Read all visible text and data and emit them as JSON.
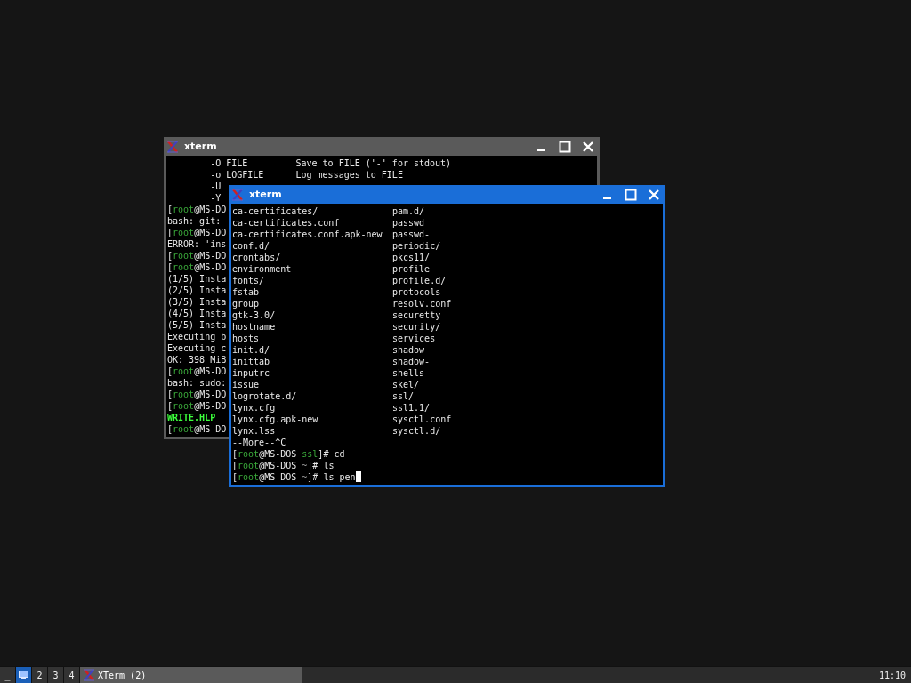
{
  "windows": [
    {
      "title": "xterm",
      "active": false,
      "lines": [
        [
          {
            "text": "        -O FILE         Save to FILE ('-' for stdout)",
            "kind": "plain"
          }
        ],
        [
          {
            "text": "        -o LOGFILE      Log messages to FILE",
            "kind": "plain"
          }
        ],
        [
          {
            "text": "        -U",
            "kind": "plain"
          }
        ],
        [
          {
            "text": "        -Y",
            "kind": "plain"
          }
        ],
        [
          {
            "text": "[",
            "kind": "plain"
          },
          {
            "text": "root",
            "kind": "green"
          },
          {
            "text": "@MS-DO",
            "kind": "plain"
          }
        ],
        [
          {
            "text": "bash: git:",
            "kind": "plain"
          }
        ],
        [
          {
            "text": "[",
            "kind": "plain"
          },
          {
            "text": "root",
            "kind": "green"
          },
          {
            "text": "@MS-DO",
            "kind": "plain"
          }
        ],
        [
          {
            "text": "ERROR: 'ins",
            "kind": "plain"
          }
        ],
        [
          {
            "text": "[",
            "kind": "plain"
          },
          {
            "text": "root",
            "kind": "green"
          },
          {
            "text": "@MS-DO",
            "kind": "plain"
          }
        ],
        [
          {
            "text": "[",
            "kind": "plain"
          },
          {
            "text": "root",
            "kind": "green"
          },
          {
            "text": "@MS-DO",
            "kind": "plain"
          }
        ],
        [
          {
            "text": "(1/5) Insta",
            "kind": "plain"
          }
        ],
        [
          {
            "text": "(2/5) Insta",
            "kind": "plain"
          }
        ],
        [
          {
            "text": "(3/5) Insta",
            "kind": "plain"
          }
        ],
        [
          {
            "text": "(4/5) Insta",
            "kind": "plain"
          }
        ],
        [
          {
            "text": "(5/5) Insta",
            "kind": "plain"
          }
        ],
        [
          {
            "text": "Executing b",
            "kind": "plain"
          }
        ],
        [
          {
            "text": "Executing c",
            "kind": "plain"
          }
        ],
        [
          {
            "text": "OK: 398 MiB",
            "kind": "plain"
          }
        ],
        [
          {
            "text": "[",
            "kind": "plain"
          },
          {
            "text": "root",
            "kind": "green"
          },
          {
            "text": "@MS-DO",
            "kind": "plain"
          }
        ],
        [
          {
            "text": "bash: sudo:",
            "kind": "plain"
          }
        ],
        [
          {
            "text": "[",
            "kind": "plain"
          },
          {
            "text": "root",
            "kind": "green"
          },
          {
            "text": "@MS-DO",
            "kind": "plain"
          }
        ],
        [
          {
            "text": "[",
            "kind": "plain"
          },
          {
            "text": "root",
            "kind": "green"
          },
          {
            "text": "@MS-DO",
            "kind": "plain"
          }
        ],
        [
          {
            "text": "WRITE.HLP",
            "kind": "bright"
          }
        ],
        [
          {
            "text": "[",
            "kind": "plain"
          },
          {
            "text": "root",
            "kind": "green"
          },
          {
            "text": "@MS-DO",
            "kind": "plain"
          }
        ]
      ]
    },
    {
      "title": "xterm",
      "active": true,
      "listing": [
        [
          "ca-certificates/",
          "pam.d/"
        ],
        [
          "ca-certificates.conf",
          "passwd"
        ],
        [
          "ca-certificates.conf.apk-new",
          "passwd-"
        ],
        [
          "conf.d/",
          "periodic/"
        ],
        [
          "crontabs/",
          "pkcs11/"
        ],
        [
          "environment",
          "profile"
        ],
        [
          "fonts/",
          "profile.d/"
        ],
        [
          "fstab",
          "protocols"
        ],
        [
          "group",
          "resolv.conf"
        ],
        [
          "gtk-3.0/",
          "securetty"
        ],
        [
          "hostname",
          "security/"
        ],
        [
          "hosts",
          "services"
        ],
        [
          "init.d/",
          "shadow"
        ],
        [
          "inittab",
          "shadow-"
        ],
        [
          "inputrc",
          "shells"
        ],
        [
          "issue",
          "skel/"
        ],
        [
          "logrotate.d/",
          "ssl/"
        ],
        [
          "lynx.cfg",
          "ssl1.1/"
        ],
        [
          "lynx.cfg.apk-new",
          "sysctl.conf"
        ],
        [
          "lynx.lss",
          "sysctl.d/"
        ]
      ],
      "lines": [
        [
          {
            "text": "--More--^C",
            "kind": "plain"
          }
        ],
        [
          {
            "text": "[",
            "kind": "plain"
          },
          {
            "text": "root",
            "kind": "green"
          },
          {
            "text": "@MS-DOS ",
            "kind": "plain"
          },
          {
            "text": "ssl",
            "kind": "green"
          },
          {
            "text": "]# cd",
            "kind": "plain"
          }
        ],
        [
          {
            "text": "[",
            "kind": "plain"
          },
          {
            "text": "root",
            "kind": "green"
          },
          {
            "text": "@MS-DOS ",
            "kind": "plain"
          },
          {
            "text": "~",
            "kind": "dim"
          },
          {
            "text": "]# ls",
            "kind": "plain"
          }
        ],
        [
          {
            "text": "[",
            "kind": "plain"
          },
          {
            "text": "root",
            "kind": "green"
          },
          {
            "text": "@MS-DOS ",
            "kind": "plain"
          },
          {
            "text": "~",
            "kind": "dim"
          },
          {
            "text": "]# ls pen",
            "kind": "plain"
          }
        ]
      ],
      "cursor": true
    }
  ],
  "taskbar": {
    "menu_button": "_",
    "workspaces": [
      {
        "kind": "icon",
        "selected": true
      },
      {
        "kind": "number",
        "label": "2",
        "selected": false
      },
      {
        "kind": "number",
        "label": "3",
        "selected": false
      },
      {
        "kind": "number",
        "label": "4",
        "selected": false
      }
    ],
    "tasks": [
      {
        "label": "XTerm (2)"
      }
    ],
    "clock": "11:10"
  }
}
